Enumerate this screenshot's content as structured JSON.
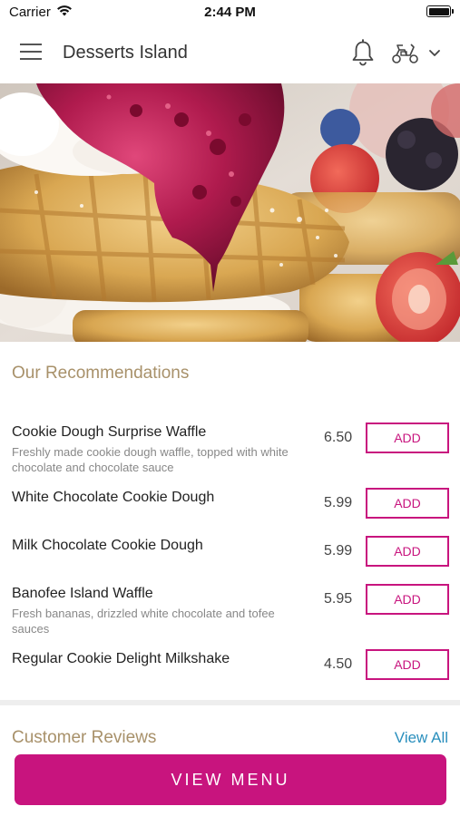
{
  "status_bar": {
    "carrier": "Carrier",
    "time": "2:44 PM"
  },
  "header": {
    "title": "Desserts Island"
  },
  "recommendations": {
    "title": "Our Recommendations",
    "items": [
      {
        "name": "Cookie Dough Surprise Waffle",
        "description": "Freshly made cookie dough waffle, topped with white chocolate and chocolate sauce",
        "price": "6.50",
        "add_label": "ADD"
      },
      {
        "name": "White Chocolate Cookie Dough",
        "description": "",
        "price": "5.99",
        "add_label": "ADD"
      },
      {
        "name": "Milk Chocolate Cookie Dough",
        "description": "",
        "price": "5.99",
        "add_label": "ADD"
      },
      {
        "name": "Banofee Island Waffle",
        "description": "Fresh bananas, drizzled white chocolate and tofee sauces",
        "price": "5.95",
        "add_label": "ADD"
      },
      {
        "name": "Regular Cookie Delight Milkshake",
        "description": "",
        "price": "4.50",
        "add_label": "ADD"
      }
    ]
  },
  "reviews": {
    "title": "Customer Reviews",
    "view_all_label": "View All"
  },
  "footer": {
    "view_menu_label": "VIEW MENU"
  },
  "colors": {
    "accent": "#c8147e",
    "section_title": "#a8916a",
    "link": "#2a8fbd"
  },
  "icons": [
    "wifi-icon",
    "battery-icon",
    "hamburger-menu-icon",
    "bell-icon",
    "scooter-icon",
    "chevron-down-icon"
  ]
}
